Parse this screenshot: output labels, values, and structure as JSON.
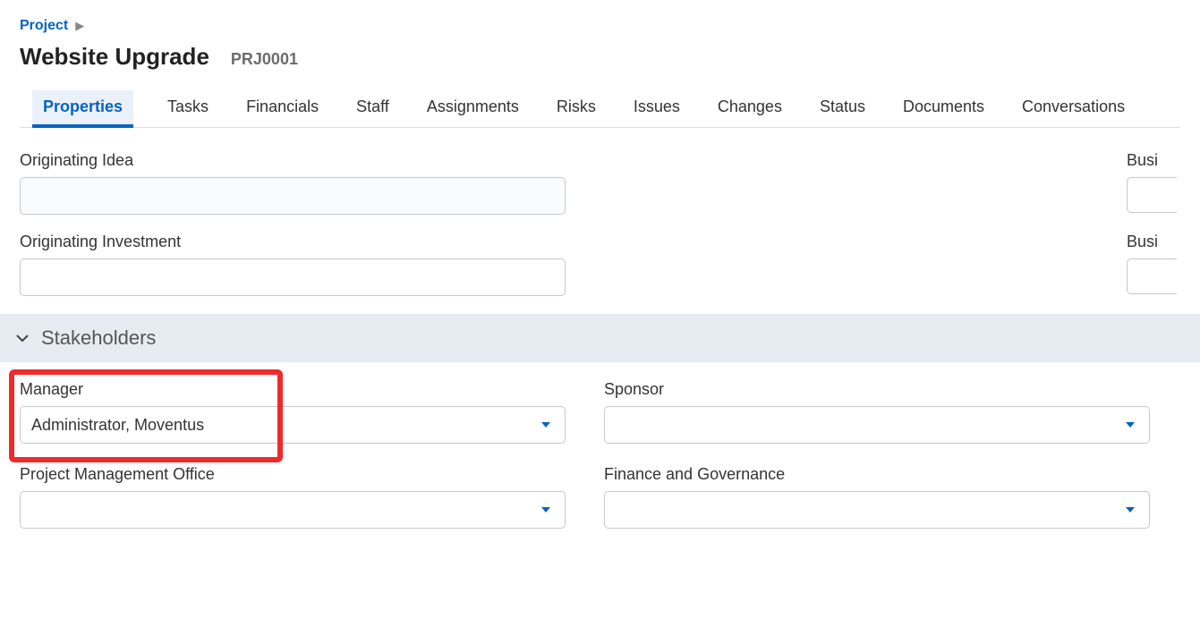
{
  "breadcrumb": {
    "label": "Project"
  },
  "header": {
    "title": "Website Upgrade",
    "code": "PRJ0001"
  },
  "tabs": [
    {
      "label": "Properties",
      "active": true
    },
    {
      "label": "Tasks"
    },
    {
      "label": "Financials"
    },
    {
      "label": "Staff"
    },
    {
      "label": "Assignments"
    },
    {
      "label": "Risks"
    },
    {
      "label": "Issues"
    },
    {
      "label": "Changes"
    },
    {
      "label": "Status"
    },
    {
      "label": "Documents"
    },
    {
      "label": "Conversations"
    }
  ],
  "fields": {
    "originating_idea": {
      "label": "Originating Idea",
      "value": ""
    },
    "originating_investment": {
      "label": "Originating Investment",
      "value": ""
    },
    "partial_right_1": {
      "label": "Busi"
    },
    "partial_right_2": {
      "label": "Busi"
    }
  },
  "section": {
    "stakeholders_title": "Stakeholders"
  },
  "stakeholders": {
    "manager": {
      "label": "Manager",
      "value": "Administrator, Moventus"
    },
    "sponsor": {
      "label": "Sponsor",
      "value": ""
    },
    "pmo": {
      "label": "Project Management Office",
      "value": ""
    },
    "finance": {
      "label": "Finance and Governance",
      "value": ""
    }
  }
}
